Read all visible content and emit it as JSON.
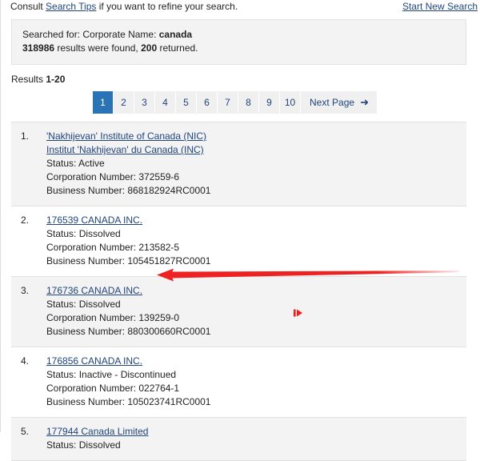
{
  "topbar": {
    "consult_prefix": "Consult ",
    "search_tips_link": "Search Tips",
    "consult_suffix": " if you want to refine your search.",
    "start_new_search_link": "Start New Search"
  },
  "summary": {
    "searched_for_label": "Searched for: Corporate Name: ",
    "searched_for_value": "canada",
    "results_found_count": "318986",
    "results_found_mid": " results were found, ",
    "results_returned_count": "200",
    "results_found_suffix": " returned."
  },
  "results_header": {
    "label": "Results ",
    "range": "1-20"
  },
  "pagination": {
    "pages": [
      "1",
      "2",
      "3",
      "4",
      "5",
      "6",
      "7",
      "8",
      "9",
      "10"
    ],
    "active_page": "1",
    "next_label": "Next Page",
    "next_arrow_glyph": "➜",
    "active_bg": "#2a74b5",
    "inactive_bg": "#f0f0f0",
    "link_color": "#20457c"
  },
  "results": [
    {
      "index": "1.",
      "names": [
        "'Nakhijevan' Institute of Canada (NIC)",
        "Institut 'Nakhijevan' du Canada (INC)"
      ],
      "status": "Status: Active",
      "corporation_number": "Corporation Number: 372559-6",
      "business_number": "Business Number: 868182924RC0001"
    },
    {
      "index": "2.",
      "names": [
        "176539 CANADA INC."
      ],
      "status": "Status: Dissolved",
      "corporation_number": "Corporation Number: 213582-5",
      "business_number": "Business Number: 105451827RC0001"
    },
    {
      "index": "3.",
      "names": [
        "176736 CANADA INC."
      ],
      "status": "Status: Dissolved",
      "corporation_number": "Corporation Number: 139259-0",
      "business_number": "Business Number: 880300660RC0001"
    },
    {
      "index": "4.",
      "names": [
        "176856 CANADA INC."
      ],
      "status": "Status: Inactive - Discontinued",
      "corporation_number": "Corporation Number: 022764-1",
      "business_number": "Business Number: 105023741RC0001"
    },
    {
      "index": "5.",
      "names": [
        "177944 Canada Limited"
      ],
      "status": "Status: Dissolved",
      "corporation_number": "",
      "business_number": ""
    }
  ],
  "annotations": {
    "arrow_color": "#ee2222",
    "marker_color": "#f21c1c"
  }
}
